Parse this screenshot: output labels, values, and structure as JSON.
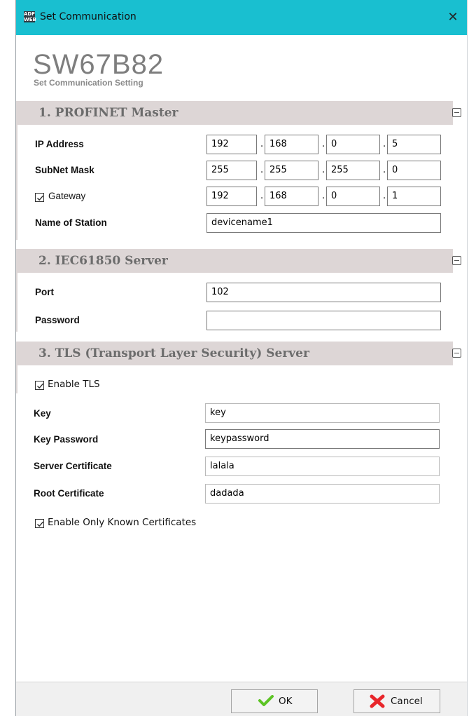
{
  "window": {
    "title": "Set Communication",
    "icon_text": "ADF WEB",
    "close_glyph": "✕"
  },
  "brand": {
    "title": "SW67B82",
    "subtitle": "Set Communication Setting"
  },
  "sections": [
    {
      "title": "1. PROFINET Master"
    },
    {
      "title": "2. IEC61850 Server"
    },
    {
      "title": "3. TLS (Transport Layer Security) Server"
    }
  ],
  "profinet": {
    "ip_label": "IP Address",
    "ip": [
      "192",
      "168",
      "0",
      "5"
    ],
    "subnet_label": "SubNet Mask",
    "subnet": [
      "255",
      "255",
      "255",
      "0"
    ],
    "gateway_label": "Gateway",
    "gateway_checked": true,
    "gateway": [
      "192",
      "168",
      "0",
      "1"
    ],
    "station_label": "Name of Station",
    "station": "devicename1",
    "separator": "."
  },
  "iec": {
    "port_label": "Port",
    "port": "102",
    "password_label": "Password",
    "password": ""
  },
  "tls": {
    "enable_label": "Enable TLS",
    "enable_checked": true,
    "key_label": "Key",
    "key": "key",
    "keypw_label": "Key Password",
    "keypw": "keypassword",
    "server_cert_label": "Server Certificate",
    "server_cert": "lalala",
    "root_cert_label": "Root Certificate",
    "root_cert": "dadada",
    "known_label": "Enable Only Known Certificates",
    "known_checked": true
  },
  "footer": {
    "ok_label": "OK",
    "cancel_label": "Cancel"
  },
  "colors": {
    "titlebar": "#19bfd0",
    "section_header": "#ddd6d6",
    "ok_check": "#5cc424",
    "cancel_x": "#e8262b"
  }
}
